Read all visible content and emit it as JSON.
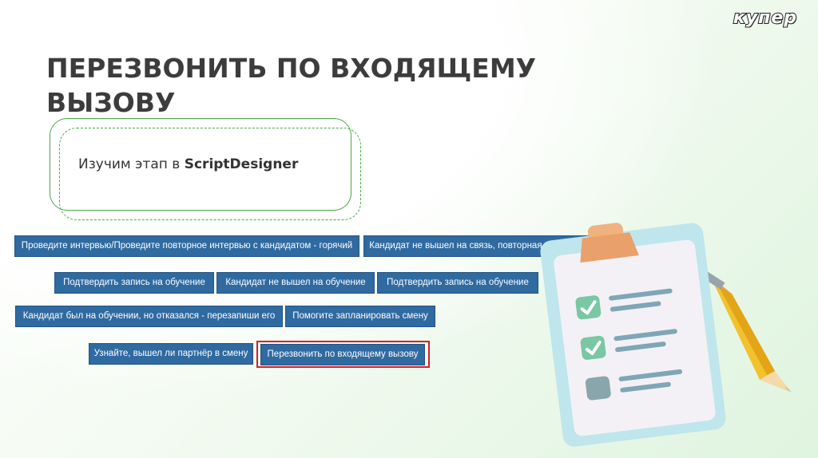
{
  "brand": {
    "logo": "купер"
  },
  "slide": {
    "title": "ПЕРЕЗВОНИТЬ ПО ВХОДЯЩЕМУ ВЫЗОВУ",
    "subtitle_prefix": "Изучим этап в ",
    "subtitle_bold": "ScriptDesigner"
  },
  "buttons": {
    "b1": "Проведите интервью/Проведите повторное интервью с кандидатом - горячий",
    "b2": "Кандидат не вышел на связь, повторная попытка - горячий",
    "b3": "Подтвердить запись на обучение",
    "b4": "Кандидат не вышел на обучение",
    "b5": "Подтвердить запись на обучение",
    "b6": "Кандидат был на обучении, но отказался - перезапиши его",
    "b7": "Помогите запланировать смену",
    "b8": "Узнайте, вышел ли партнёр в смену",
    "b9": "Перезвонить по входящему вызову"
  },
  "colors": {
    "button_bg": "#2f6aa1",
    "highlight": "#d81e2a",
    "frame": "#49a74a",
    "title": "#3c3c3c"
  },
  "icons": [
    "clipboard-checklist-icon",
    "pencil-icon",
    "checkmark-icon"
  ]
}
